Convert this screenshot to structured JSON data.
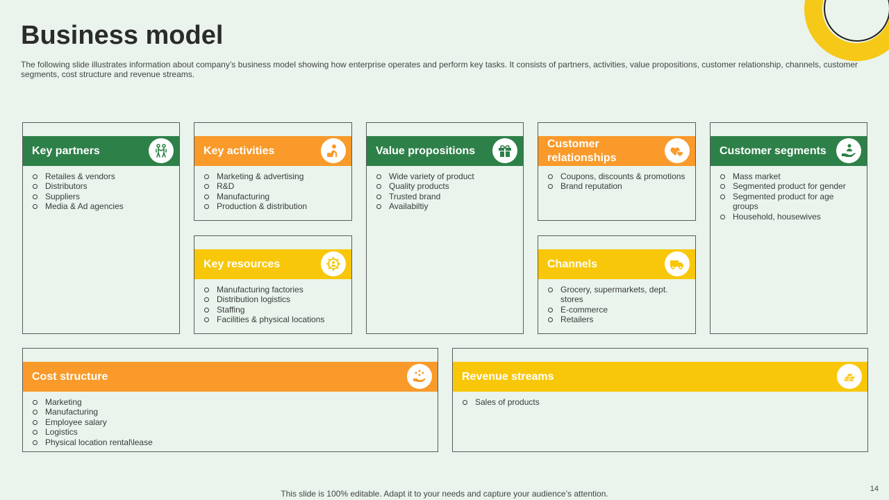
{
  "slide": {
    "title": "Business model",
    "subtitle": "The following slide illustrates information about company’s business model showing how enterprise operates and perform key tasks. It consists of partners, activities, value propositions, customer relationship, channels, customer segments, cost structure and revenue streams.",
    "footer": "This slide is 100% editable. Adapt it to your needs and capture your audience’s attention.",
    "page_number": "14"
  },
  "colors": {
    "green": "#2e8049",
    "orange": "#f99a2a",
    "yellow": "#f8c709",
    "background": "#eaf4ec"
  },
  "cards": {
    "partners": {
      "title": "Key partners",
      "icon": "partners-icon",
      "items": [
        "Retailes & vendors",
        "Distributors",
        "Suppliers",
        "Media & Ad agencies"
      ]
    },
    "activities": {
      "title": "Key activities",
      "icon": "worker-icon",
      "items": [
        "Marketing & advertising",
        "R&D",
        "Manufacturing",
        "Production & distribution"
      ]
    },
    "resources": {
      "title": "Key resources",
      "icon": "gear-people-icon",
      "items": [
        "Manufacturing factories",
        "Distribution logistics",
        "Staffing",
        "Facilities & physical locations"
      ]
    },
    "value": {
      "title": "Value propositions",
      "icon": "gift-icon",
      "items": [
        "Wide variety of product",
        "Quality products",
        "Trusted brand",
        "Availabiltiy"
      ]
    },
    "relationships": {
      "title": "Customer relationships",
      "icon": "hearts-icon",
      "items": [
        "Coupons, discounts & promotions",
        "Brand reputation"
      ]
    },
    "channels": {
      "title": "Channels",
      "icon": "truck-icon",
      "items": [
        "Grocery, supermarkets, dept. stores",
        "E-commerce",
        "Retailers"
      ]
    },
    "segments": {
      "title": "Customer segments",
      "icon": "hand-person-icon",
      "items": [
        "Mass market",
        "Segmented product for gender",
        "Segmented product for age groups",
        "Household, housewives"
      ]
    },
    "cost": {
      "title": "Cost structure",
      "icon": "coins-hand-icon",
      "items": [
        "Marketing",
        "Manufacturing",
        "Employee salary",
        "Logistics",
        "Physical location rental\\lease"
      ]
    },
    "revenue": {
      "title": "Revenue streams",
      "icon": "gold-bars-icon",
      "items": [
        "Sales of products"
      ]
    }
  }
}
